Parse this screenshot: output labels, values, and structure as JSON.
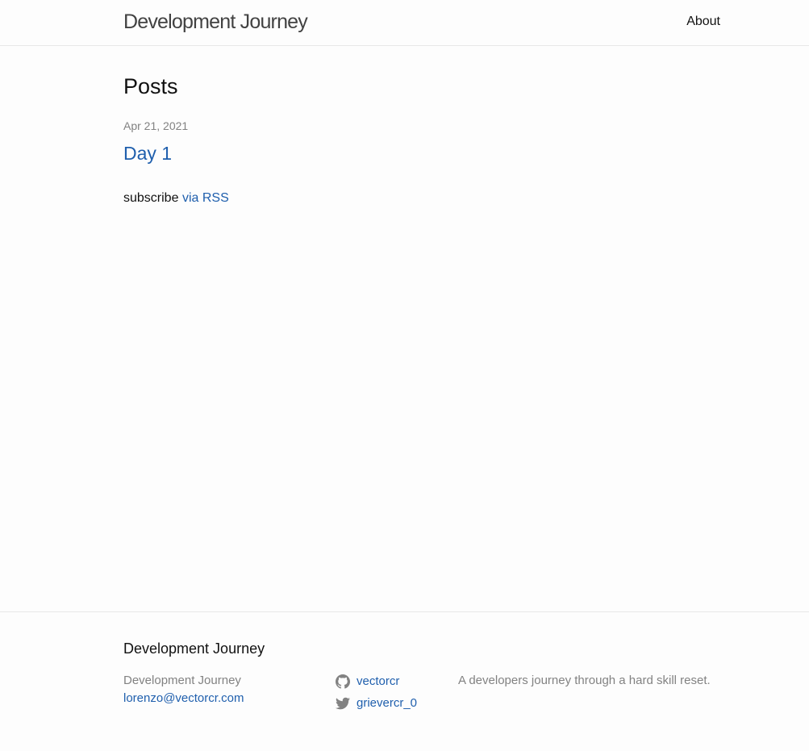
{
  "header": {
    "site_title": "Development Journey",
    "nav": [
      {
        "label": "About"
      }
    ]
  },
  "main": {
    "heading": "Posts",
    "posts": [
      {
        "date": "Apr 21, 2021",
        "title": "Day 1"
      }
    ],
    "rss": {
      "prefix": "subscribe",
      "link_label": "via RSS"
    }
  },
  "footer": {
    "heading": "Development Journey",
    "name": "Development Journey",
    "email": "lorenzo@vectorcr.com",
    "social": [
      {
        "icon": "github-icon",
        "label": "vectorcr"
      },
      {
        "icon": "twitter-icon",
        "label": "grievercr_0"
      }
    ],
    "description": "A developers journey through a hard skill reset."
  },
  "colors": {
    "link": "#1f5fad",
    "muted": "#828282",
    "border": "#e8e8e8",
    "text": "#111111"
  }
}
